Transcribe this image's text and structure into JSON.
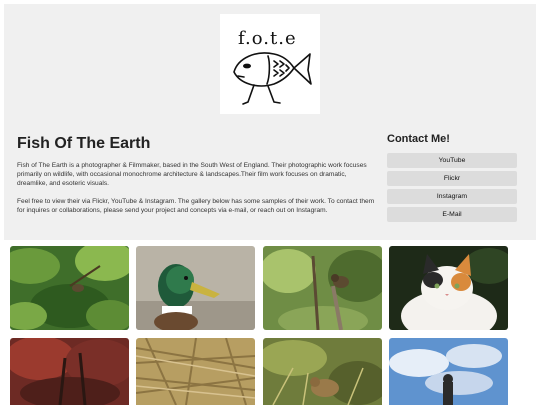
{
  "logo": {
    "text": "f.o.t.e",
    "icon": "fish-drawing-icon"
  },
  "about": {
    "title": "Fish Of The Earth",
    "paragraph_1": "Fish of The Earth is a photographer & Filmmaker, based in the South West of England. Their photographic work focuses primarily on wildlife, with occasional monochrome architecture & landscapes.Their film work focuses on dramatic, dreamlike, and esoteric visuals.",
    "paragraph_2": "Feel free to view their via Flickr, YouTube & Instagram. The gallery below has some samples of their work. To contact them for inquires or collaborations, please send your project and concepts via e-mail, or reach out on Instagram."
  },
  "contact": {
    "title": "Contact Me!",
    "buttons": [
      {
        "label": "YouTube"
      },
      {
        "label": "Flickr"
      },
      {
        "label": "Instagram"
      },
      {
        "label": "E-Mail"
      }
    ]
  },
  "colors": {
    "panel": "#f0f0f0",
    "button": "#dcdcdc",
    "text": "#222222"
  }
}
